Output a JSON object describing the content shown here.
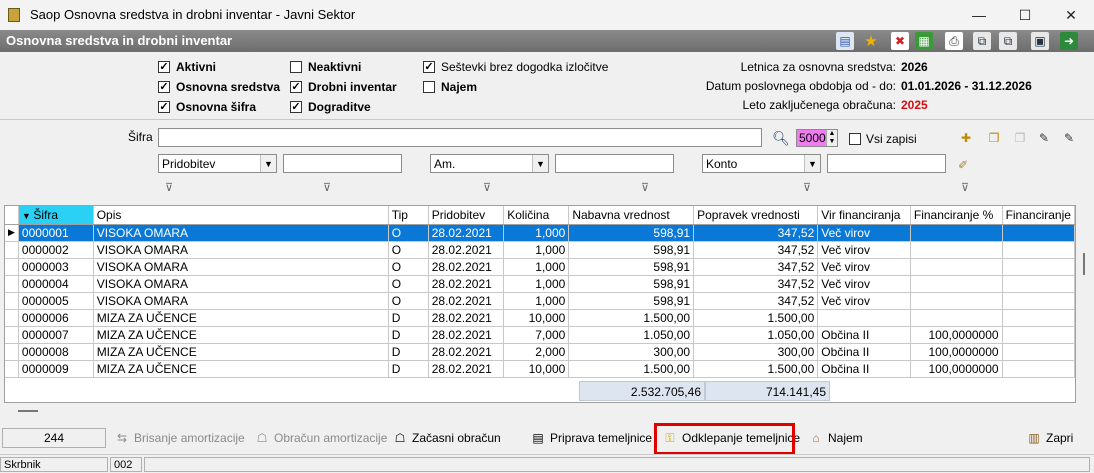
{
  "window": {
    "title": "Saop Osnovna sredstva in drobni inventar - Javni Sektor",
    "minimize": "—",
    "maximize": "☐",
    "close": "✕"
  },
  "header": {
    "title": "Osnovna sredstva in drobni inventar"
  },
  "filters": {
    "col1": [
      {
        "label": "Aktivni",
        "checked": true
      },
      {
        "label": "Osnovna sredstva",
        "checked": true
      },
      {
        "label": "Osnovna šifra",
        "checked": true
      }
    ],
    "col2": [
      {
        "label": "Neaktivni",
        "checked": false
      },
      {
        "label": "Drobni inventar",
        "checked": true
      },
      {
        "label": "Dograditve",
        "checked": true
      }
    ],
    "col3": [
      {
        "label": "Seštevki brez dogodka izločitve",
        "checked": true
      },
      {
        "label": "Najem",
        "checked": false
      }
    ]
  },
  "info": {
    "letnica_label": "Letnica za osnovna sredstva:",
    "letnica_value": "2026",
    "datum_label": "Datum poslovnega obdobja od - do:",
    "datum_value": "01.01.2026 - 31.12.2026",
    "leto_label": "Leto zaključenega obračuna:",
    "leto_value": "2025"
  },
  "search": {
    "sifra_label": "Šifra",
    "sifra_value": "",
    "limit": "5000",
    "vsi_zapisi": "Vsi zapisi"
  },
  "combos": {
    "c1": "Pridobitev",
    "c2": "Am.",
    "c3": "Konto"
  },
  "grid": {
    "columns": [
      "Šifra",
      "Opis",
      "Tip",
      "Pridobitev",
      "Količina",
      "Nabavna vrednost",
      "Popravek vrednosti",
      "Vir financiranja",
      "Financiranje %",
      "Financiranje"
    ],
    "rows": [
      [
        "0000001",
        "VISOKA OMARA",
        "O",
        "28.02.2021",
        "1,000",
        "598,91",
        "347,52",
        "Več virov",
        "",
        ""
      ],
      [
        "0000002",
        "VISOKA OMARA",
        "O",
        "28.02.2021",
        "1,000",
        "598,91",
        "347,52",
        "Več virov",
        "",
        ""
      ],
      [
        "0000003",
        "VISOKA OMARA",
        "O",
        "28.02.2021",
        "1,000",
        "598,91",
        "347,52",
        "Več virov",
        "",
        ""
      ],
      [
        "0000004",
        "VISOKA OMARA",
        "O",
        "28.02.2021",
        "1,000",
        "598,91",
        "347,52",
        "Več virov",
        "",
        ""
      ],
      [
        "0000005",
        "VISOKA OMARA",
        "O",
        "28.02.2021",
        "1,000",
        "598,91",
        "347,52",
        "Več virov",
        "",
        ""
      ],
      [
        "0000006",
        "MIZA ZA UČENCE",
        "D",
        "28.02.2021",
        "10,000",
        "1.500,00",
        "1.500,00",
        "",
        "",
        ""
      ],
      [
        "0000007",
        "MIZA ZA UČENCE",
        "D",
        "28.02.2021",
        "7,000",
        "1.050,00",
        "1.050,00",
        "Občina II",
        "100,0000000",
        ""
      ],
      [
        "0000008",
        "MIZA ZA UČENCE",
        "D",
        "28.02.2021",
        "2,000",
        "300,00",
        "300,00",
        "Občina II",
        "100,0000000",
        ""
      ],
      [
        "0000009",
        "MIZA ZA UČENCE",
        "D",
        "28.02.2021",
        "10,000",
        "1.500,00",
        "1.500,00",
        "Občina II",
        "100,0000000",
        ""
      ]
    ],
    "sum_nabavna": "2.532.705,46",
    "sum_popravek": "714.141,45"
  },
  "bottom": {
    "count": "244",
    "brisanje": "Brisanje amortizacije",
    "obracun": "Obračun amortizacije",
    "zacasni": "Začasni obračun",
    "priprava": "Priprava temeljnice",
    "odklepanje": "Odklepanje temeljnice",
    "najem": "Najem",
    "zapri": "Zapri"
  },
  "status": {
    "user": "Skrbnik",
    "code": "002"
  },
  "colors": {
    "header_bg": "#7a7a7a",
    "selected_row": "#0a78d7",
    "leto_red": "#d01010",
    "highlight_box": "#e00000",
    "limit_bg": "#f07cf0"
  }
}
